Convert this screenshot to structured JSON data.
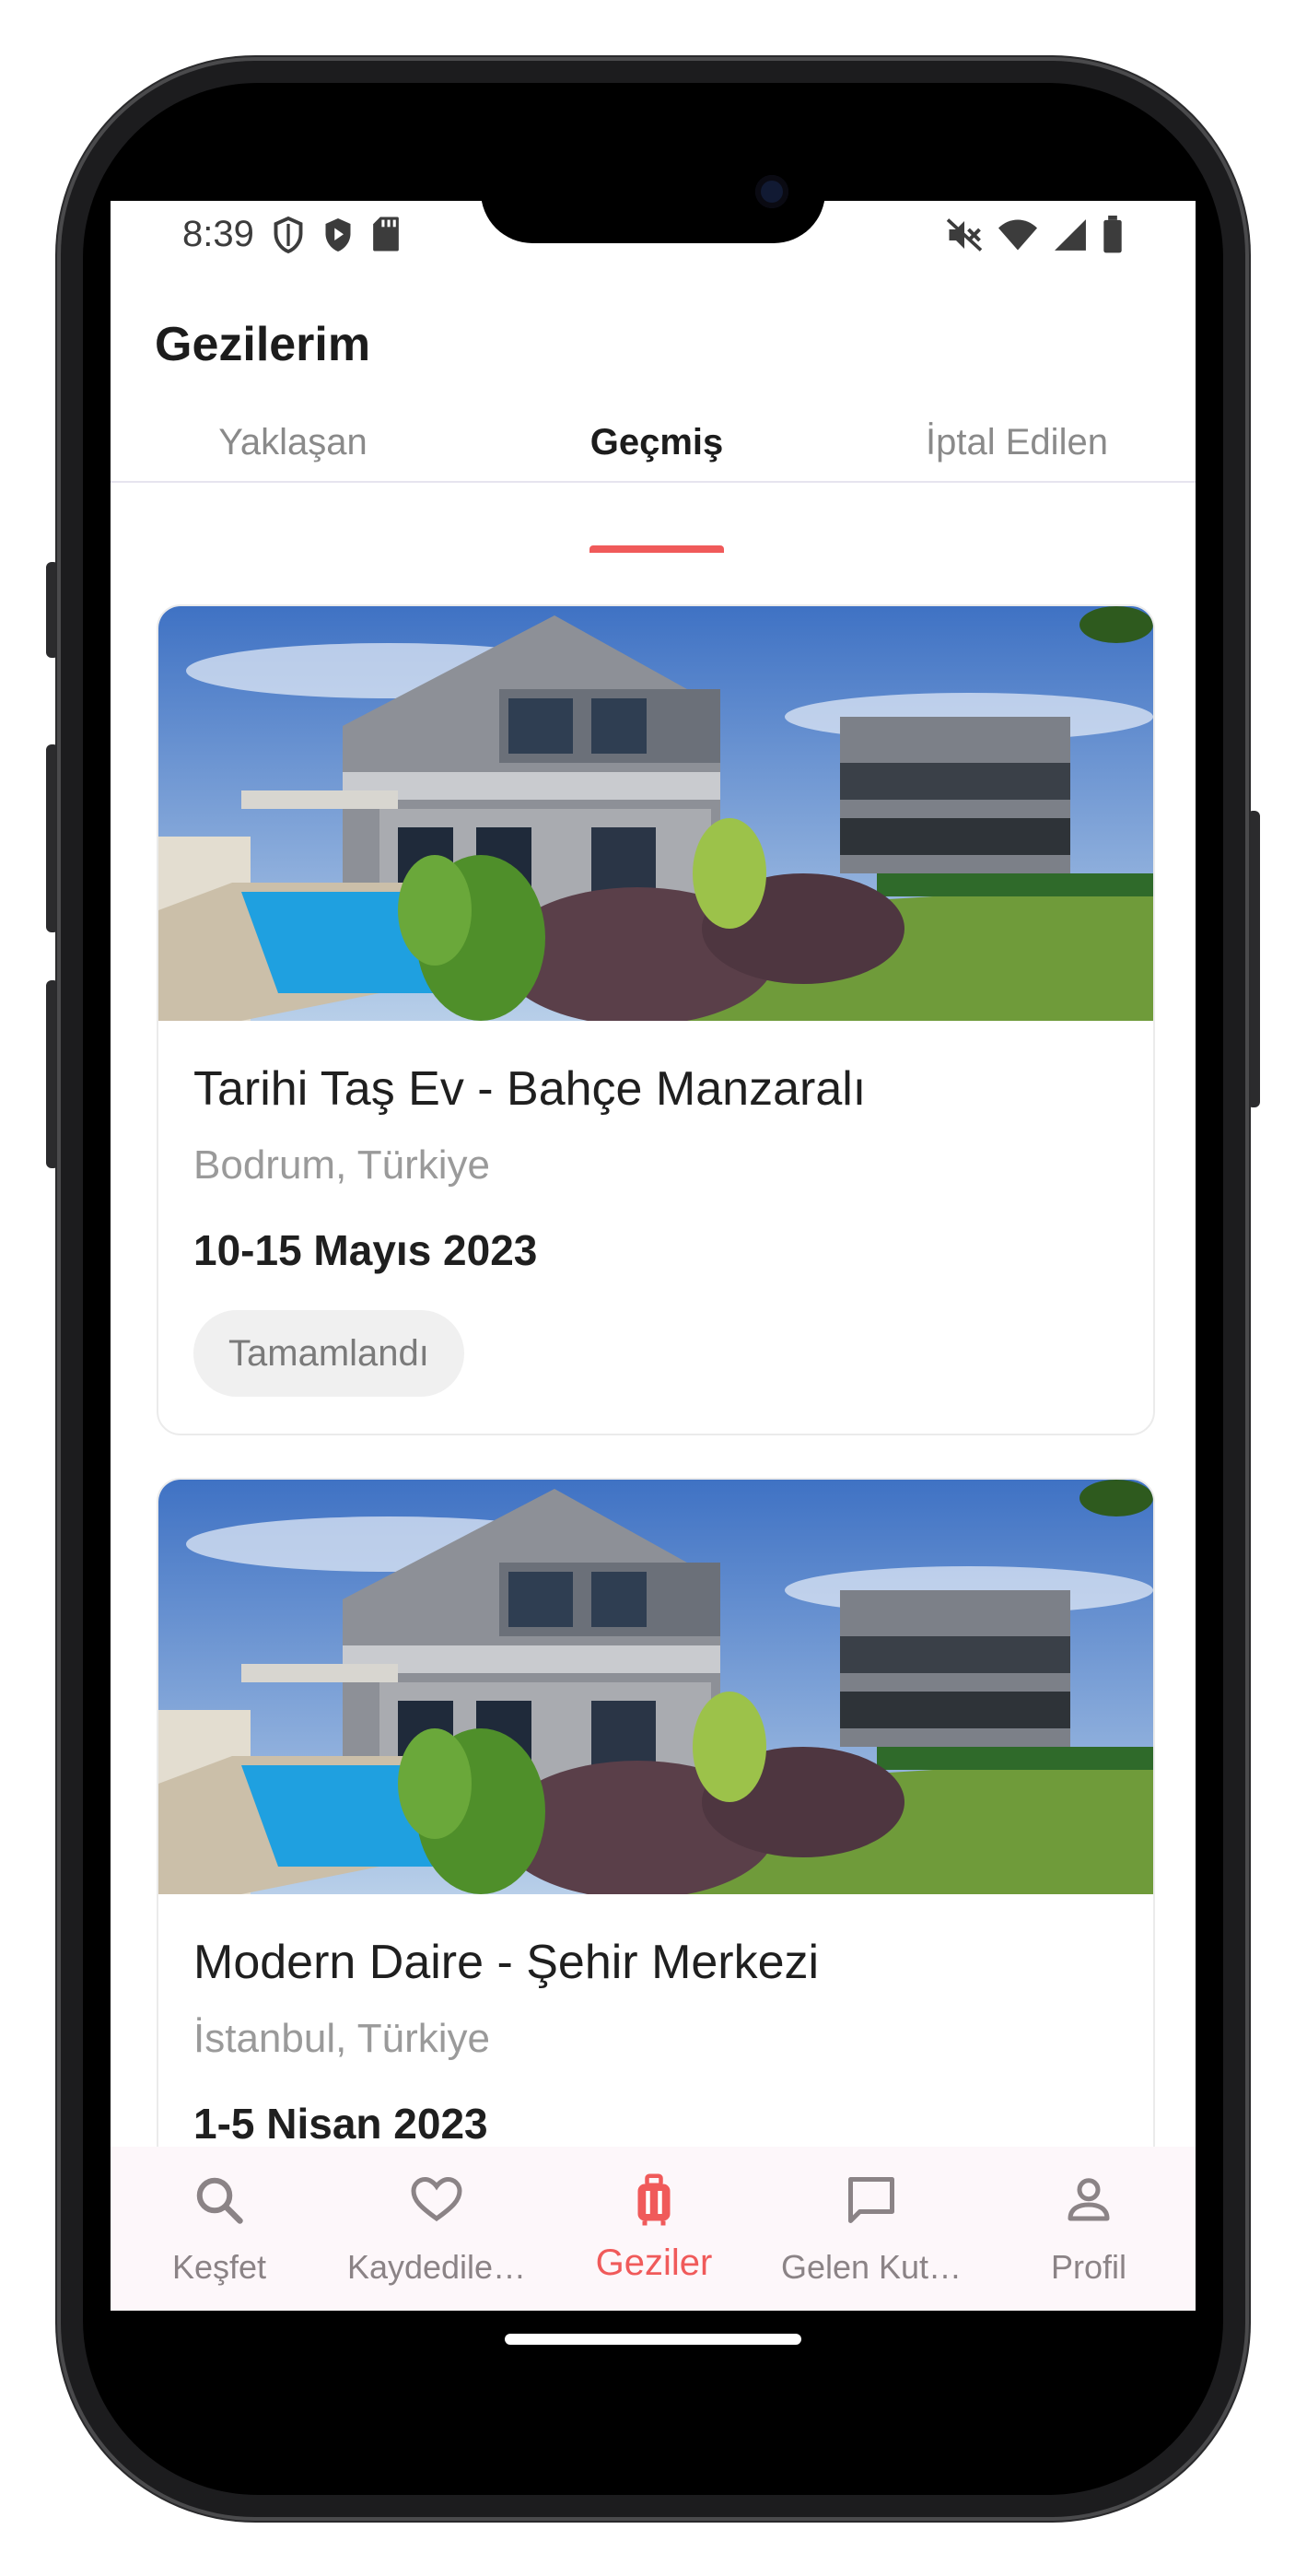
{
  "status_bar": {
    "time": "8:39",
    "left_icons": [
      "shield-outline-icon",
      "shield-play-icon",
      "sd-card-icon"
    ],
    "right_icons": [
      "mute-icon",
      "wifi-icon",
      "cell-signal-icon",
      "battery-icon"
    ]
  },
  "header": {
    "title": "Gezilerim"
  },
  "tabs": [
    {
      "label": "Yaklaşan"
    },
    {
      "label": "Geçmiş",
      "active": true
    },
    {
      "label": "İptal Edilen"
    }
  ],
  "trips": [
    {
      "title": "Tarihi Taş Ev - Bahçe Manzaralı",
      "location": "Bodrum, Türkiye",
      "dates": "10-15 Mayıs 2023",
      "status": "Tamamlandı"
    },
    {
      "title": "Modern Daire - Şehir Merkezi",
      "location": "İstanbul, Türkiye",
      "dates": "1-5 Nisan 2023"
    }
  ],
  "bottom_nav": [
    {
      "label": "Keşfet",
      "icon": "search-icon"
    },
    {
      "label": "Kaydedile…",
      "icon": "heart-icon"
    },
    {
      "label": "Geziler",
      "icon": "luggage-icon",
      "active": true
    },
    {
      "label": "Gelen Kut…",
      "icon": "chat-icon"
    },
    {
      "label": "Profil",
      "icon": "person-icon"
    }
  ],
  "colors": {
    "accent": "#f05a5a",
    "tab_divider": "#e6e4ef",
    "nav_background": "#fdf7fa"
  }
}
